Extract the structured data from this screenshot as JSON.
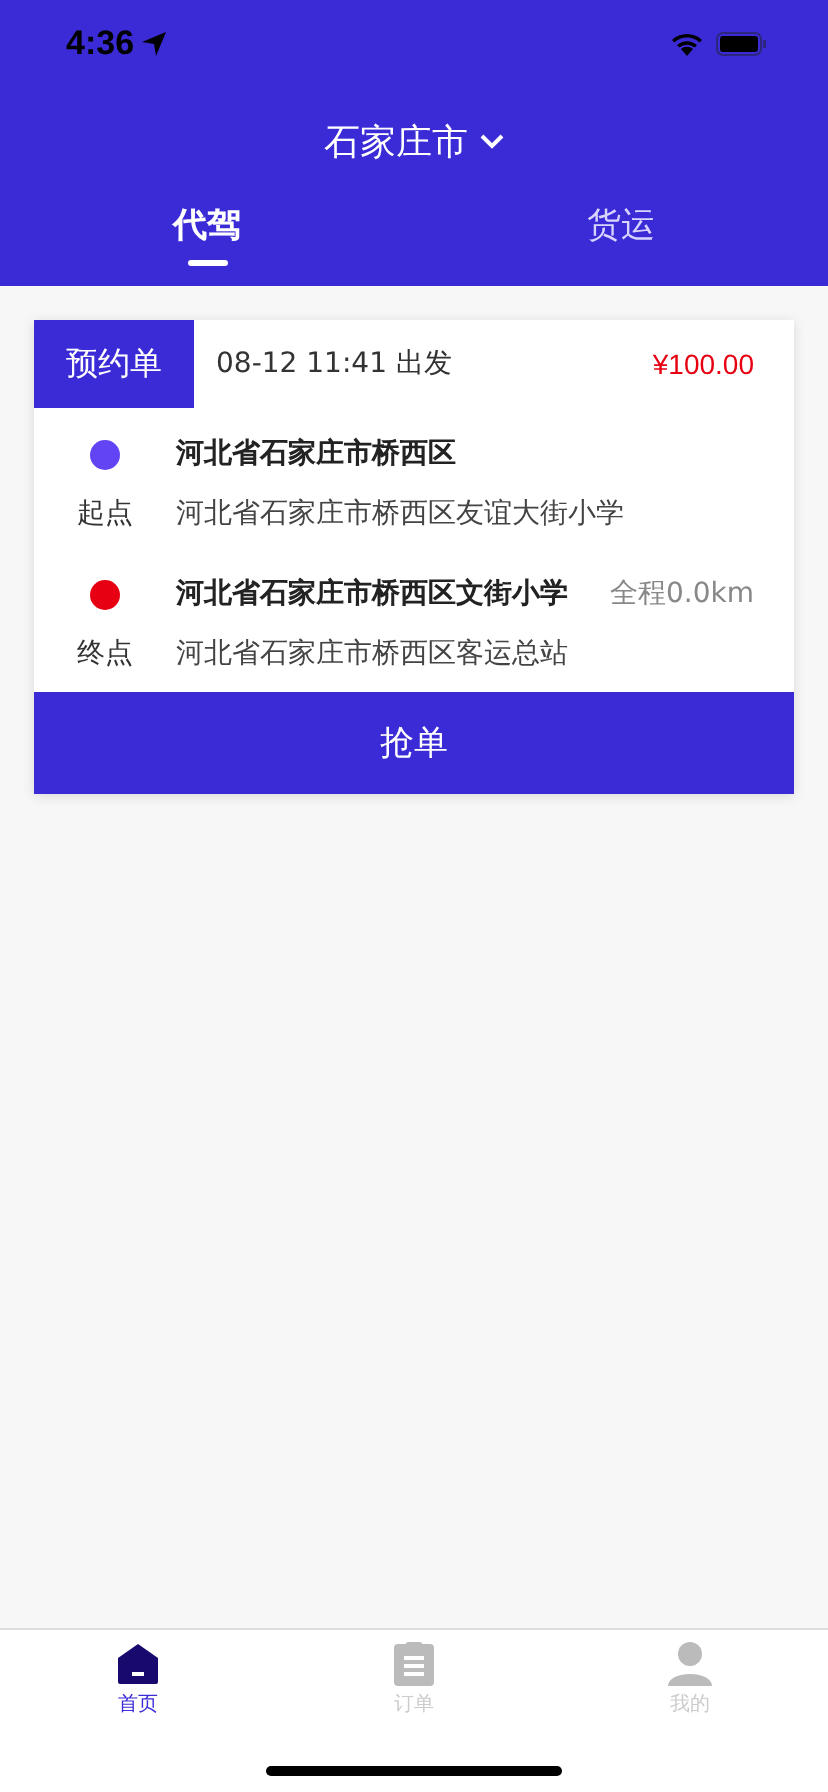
{
  "status_bar": {
    "time": "4:36"
  },
  "header": {
    "city": "石家庄市"
  },
  "tabs": [
    {
      "label": "代驾",
      "selected": true
    },
    {
      "label": "货运",
      "selected": false
    }
  ],
  "orders": [
    {
      "badge": "预约单",
      "departure": "08-12 11:41 出发",
      "price": "¥100.00",
      "stops": [
        {
          "color": "#6244f5",
          "label": "起点",
          "title": "河北省石家庄市桥西区",
          "address": "河北省石家庄市桥西区友谊大街小学"
        },
        {
          "color": "#e60012",
          "label": "终点",
          "title": "河北省石家庄市桥西区文街小学",
          "distance": "全程0.0km",
          "address": "河北省石家庄市桥西区客运总站"
        }
      ],
      "action": "抢单"
    }
  ],
  "tab_bar": [
    {
      "label": "首页",
      "selected": true,
      "kind": "home"
    },
    {
      "label": "订单",
      "selected": false,
      "kind": "orders"
    },
    {
      "label": "我的",
      "selected": false,
      "kind": "profile"
    }
  ]
}
